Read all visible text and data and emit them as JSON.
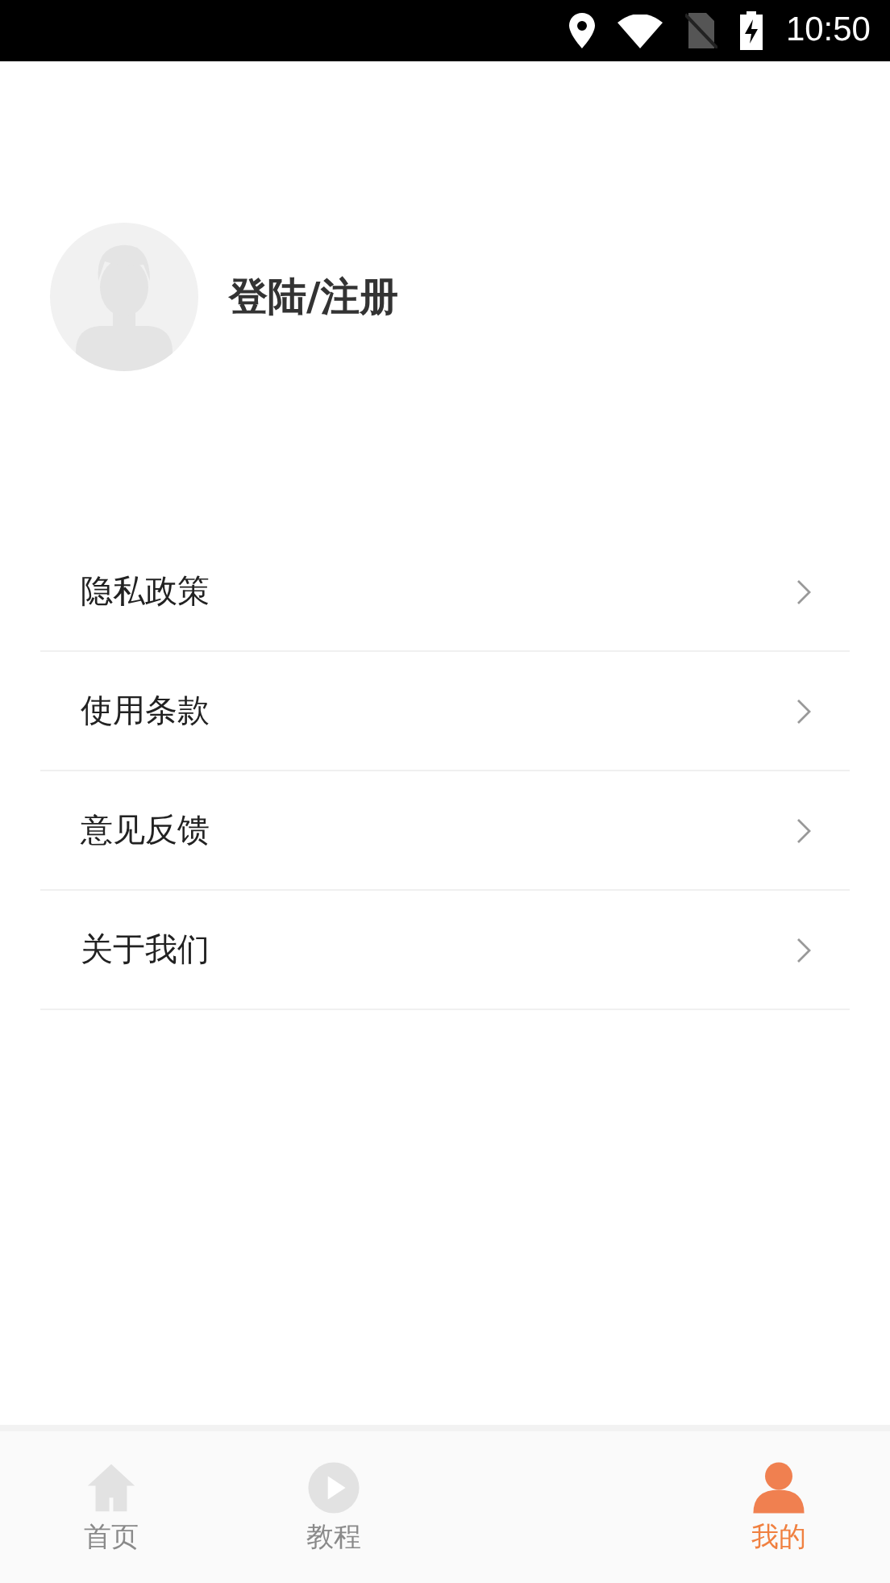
{
  "status_bar": {
    "time": "10:50"
  },
  "profile": {
    "login_label": "登陆/注册"
  },
  "menu": [
    {
      "label": "隐私政策"
    },
    {
      "label": "使用条款"
    },
    {
      "label": "意见反馈"
    },
    {
      "label": "关于我们"
    }
  ],
  "tab_bar": [
    {
      "label": "首页",
      "kind": "home",
      "selected": false
    },
    {
      "label": "教程",
      "kind": "play",
      "selected": false
    },
    {
      "label": "我的",
      "kind": "person",
      "selected": true
    }
  ]
}
